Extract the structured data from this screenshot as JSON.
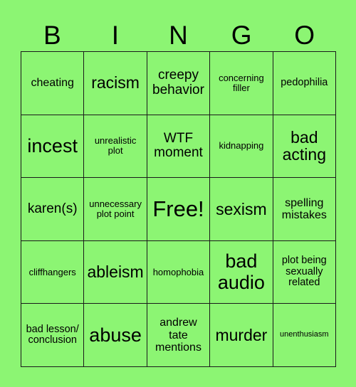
{
  "card": {
    "background_color": "#8cf573",
    "border_color": "#1a1a1a",
    "text_color": "#000000",
    "header": {
      "letters": [
        "B",
        "I",
        "N",
        "G",
        "O"
      ]
    },
    "grid": {
      "rows": 5,
      "columns": 5,
      "cells": [
        {
          "label": "cheating",
          "size": "m",
          "free": false
        },
        {
          "label": "racism",
          "size": "xl",
          "free": false
        },
        {
          "label": "creepy behavior",
          "size": "l",
          "free": false
        },
        {
          "label": "concerning filler",
          "size": "xs",
          "free": false
        },
        {
          "label": "pedophilia",
          "size": "s",
          "free": false
        },
        {
          "label": "incest",
          "size": "xxl",
          "free": false
        },
        {
          "label": "unrealistic plot",
          "size": "xs",
          "free": false
        },
        {
          "label": "WTF moment",
          "size": "l",
          "free": false
        },
        {
          "label": "kidnapping",
          "size": "xs",
          "free": false
        },
        {
          "label": "bad acting",
          "size": "xl",
          "free": false
        },
        {
          "label": "karen(s)",
          "size": "l",
          "free": false
        },
        {
          "label": "unnecessary plot point",
          "size": "xs",
          "free": false
        },
        {
          "label": "Free!",
          "size": "free",
          "free": true
        },
        {
          "label": "sexism",
          "size": "xl",
          "free": false
        },
        {
          "label": "spelling mistakes",
          "size": "m",
          "free": false
        },
        {
          "label": "cliffhangers",
          "size": "xs",
          "free": false
        },
        {
          "label": "ableism",
          "size": "xl",
          "free": false
        },
        {
          "label": "homophobia",
          "size": "xs",
          "free": false
        },
        {
          "label": "bad audio",
          "size": "xxl",
          "free": false
        },
        {
          "label": "plot being sexually related",
          "size": "s",
          "free": false
        },
        {
          "label": "bad lesson/ conclusion",
          "size": "s",
          "free": false
        },
        {
          "label": "abuse",
          "size": "xxl",
          "free": false
        },
        {
          "label": "andrew tate mentions",
          "size": "m",
          "free": false
        },
        {
          "label": "murder",
          "size": "xl",
          "free": false
        },
        {
          "label": "unenthusiasm",
          "size": "xxs",
          "free": false
        }
      ]
    }
  }
}
